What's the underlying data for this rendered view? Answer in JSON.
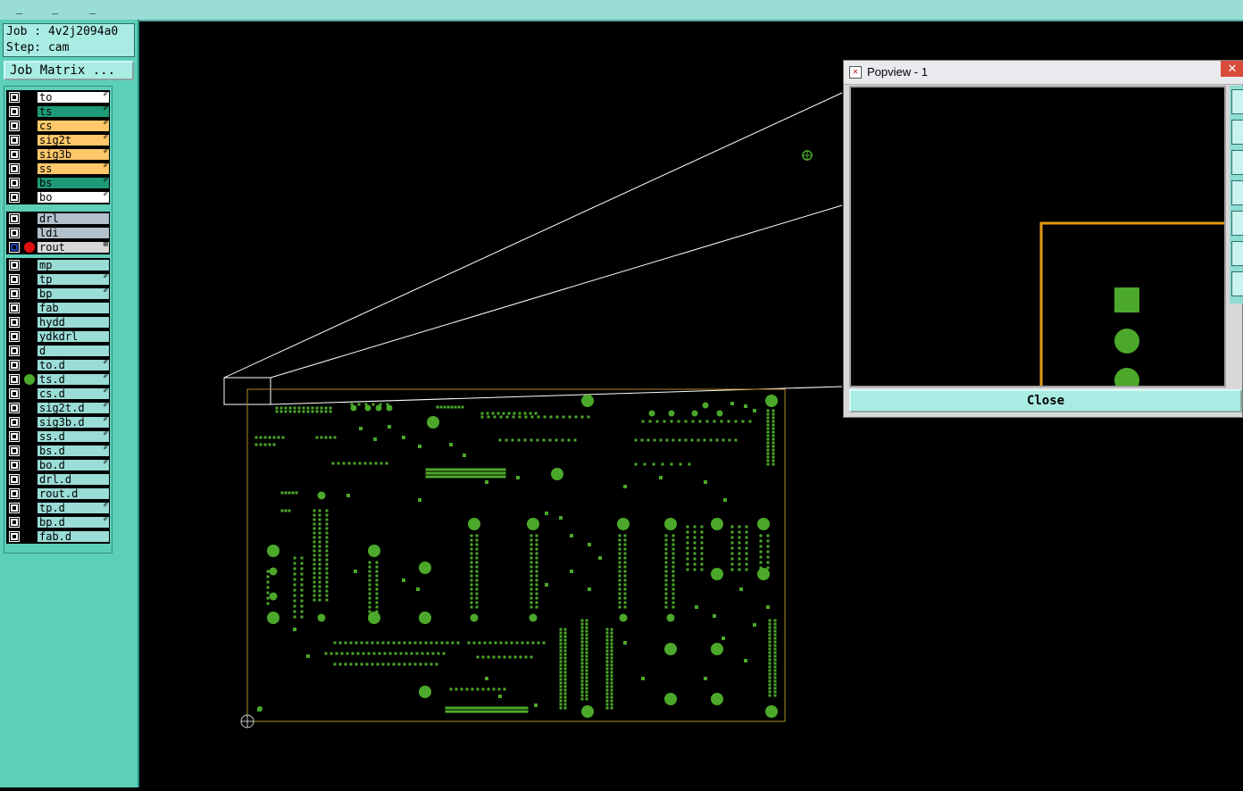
{
  "info": {
    "job": "Job : 4v2j2094a0",
    "step": "Step: cam"
  },
  "job_matrix_label": "Job Matrix ...",
  "layers": [
    {
      "name": "to",
      "color": "#ffffff",
      "flag": "✐",
      "dot": null
    },
    {
      "name": "ts",
      "color": "#1f9a78",
      "flag": "✐",
      "dot": null
    },
    {
      "name": "cs",
      "color": "#ffc86a",
      "flag": "✐",
      "dot": null
    },
    {
      "name": "sig2t",
      "color": "#ffc86a",
      "flag": "✐",
      "dot": null
    },
    {
      "name": "sig3b",
      "color": "#ffc86a",
      "flag": "✐",
      "dot": null
    },
    {
      "name": "ss",
      "color": "#ffc86a",
      "flag": "✐",
      "dot": null
    },
    {
      "name": "bs",
      "color": "#1f9a78",
      "flag": "✐",
      "dot": null
    },
    {
      "name": "bo",
      "color": "#ffffff",
      "flag": "✐",
      "dot": null
    },
    {
      "name": "drl",
      "color": "#b3c1cc",
      "flag": "",
      "dot": null
    },
    {
      "name": "ldi",
      "color": "#b3c1cc",
      "flag": "",
      "dot": null
    },
    {
      "name": "rout",
      "color": "#d8d8d8",
      "flag": "⊞",
      "dot": "#e01010"
    },
    {
      "name": "mp",
      "color": "#9adcd6",
      "flag": "",
      "dot": null
    },
    {
      "name": "tp",
      "color": "#9adcd6",
      "flag": "✐",
      "dot": null
    },
    {
      "name": "bp",
      "color": "#9adcd6",
      "flag": "✐",
      "dot": null
    },
    {
      "name": "fab",
      "color": "#9adcd6",
      "flag": "",
      "dot": null
    },
    {
      "name": "hydd",
      "color": "#9adcd6",
      "flag": "",
      "dot": null
    },
    {
      "name": "ydkdrl",
      "color": "#9adcd6",
      "flag": "",
      "dot": null
    },
    {
      "name": "d",
      "color": "#9adcd6",
      "flag": "",
      "dot": null
    },
    {
      "name": "to.d",
      "color": "#9adcd6",
      "flag": "✐",
      "dot": null
    },
    {
      "name": "ts.d",
      "color": "#9adcd6",
      "flag": "✐",
      "dot": "#4ca82a"
    },
    {
      "name": "cs.d",
      "color": "#9adcd6",
      "flag": "✐",
      "dot": null
    },
    {
      "name": "sig2t.d",
      "color": "#9adcd6",
      "flag": "✐",
      "dot": null
    },
    {
      "name": "sig3b.d",
      "color": "#9adcd6",
      "flag": "✐",
      "dot": null
    },
    {
      "name": "ss.d",
      "color": "#9adcd6",
      "flag": "✐",
      "dot": null
    },
    {
      "name": "bs.d",
      "color": "#9adcd6",
      "flag": "✐",
      "dot": null
    },
    {
      "name": "bo.d",
      "color": "#9adcd6",
      "flag": "✐",
      "dot": null
    },
    {
      "name": "drl.d",
      "color": "#9adcd6",
      "flag": "",
      "dot": null
    },
    {
      "name": "rout.d",
      "color": "#9adcd6",
      "flag": "",
      "dot": null
    },
    {
      "name": "tp.d",
      "color": "#9adcd6",
      "flag": "✐",
      "dot": null
    },
    {
      "name": "bp.d",
      "color": "#9adcd6",
      "flag": "✐",
      "dot": null
    },
    {
      "name": "fab.d",
      "color": "#9adcd6",
      "flag": "",
      "dot": null
    }
  ],
  "popview": {
    "title": "Popview - 1",
    "close_x": "✕",
    "close_label": "Close",
    "tool_icons": [
      "zoom-icon",
      "pan-icon",
      "fit-icon",
      "flip-icon",
      "frame-icon",
      "step-icon",
      "snap-icon"
    ]
  },
  "colors": {
    "pad_green": "#4ca82a",
    "board_outline": "#b08a2a",
    "rout_orange": "#e29a10"
  }
}
